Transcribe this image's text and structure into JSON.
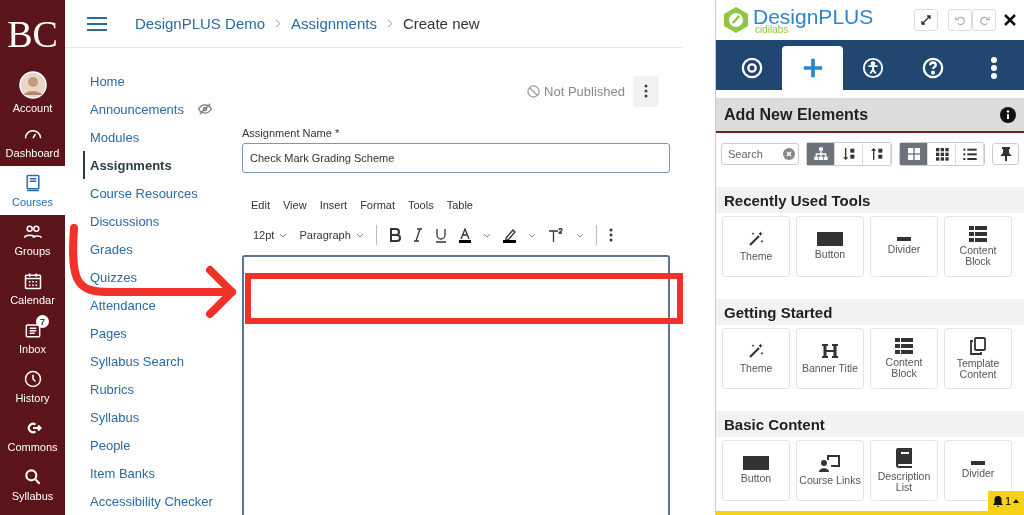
{
  "global_nav": {
    "logo": "BC",
    "items": [
      {
        "label": "Account",
        "selected": false
      },
      {
        "label": "Dashboard",
        "selected": false
      },
      {
        "label": "Courses",
        "selected": true
      },
      {
        "label": "Groups",
        "selected": false
      },
      {
        "label": "Calendar",
        "selected": false
      },
      {
        "label": "Inbox",
        "selected": false,
        "badge": "7"
      },
      {
        "label": "History",
        "selected": false
      },
      {
        "label": "Commons",
        "selected": false
      },
      {
        "label": "Syllabus",
        "selected": false
      }
    ]
  },
  "breadcrumb": [
    "DesignPLUS Demo",
    "Assignments",
    "Create new"
  ],
  "course_nav": [
    {
      "label": "Home",
      "selected": false,
      "hidden": false
    },
    {
      "label": "Announcements",
      "selected": false,
      "hidden": true
    },
    {
      "label": "Modules",
      "selected": false,
      "hidden": false
    },
    {
      "label": "Assignments",
      "selected": true,
      "hidden": false
    },
    {
      "label": "Course Resources",
      "selected": false,
      "hidden": false
    },
    {
      "label": "Discussions",
      "selected": false,
      "hidden": false
    },
    {
      "label": "Grades",
      "selected": false,
      "hidden": false
    },
    {
      "label": "Quizzes",
      "selected": false,
      "hidden": false
    },
    {
      "label": "Attendance",
      "selected": false,
      "hidden": false
    },
    {
      "label": "Pages",
      "selected": false,
      "hidden": false
    },
    {
      "label": "Syllabus Search",
      "selected": false,
      "hidden": false
    },
    {
      "label": "Rubrics",
      "selected": false,
      "hidden": false
    },
    {
      "label": "Syllabus",
      "selected": false,
      "hidden": false
    },
    {
      "label": "People",
      "selected": false,
      "hidden": false
    },
    {
      "label": "Item Banks",
      "selected": false,
      "hidden": false
    },
    {
      "label": "Accessibility Checker",
      "selected": false,
      "hidden": false
    }
  ],
  "publish_status": "Not Published",
  "assignment_name": {
    "label": "Assignment Name *",
    "value": "Check Mark Grading Scheme"
  },
  "editor": {
    "menu": [
      "Edit",
      "View",
      "Insert",
      "Format",
      "Tools",
      "Table"
    ],
    "font_size": "12pt",
    "block_format": "Paragraph"
  },
  "designplus": {
    "logo_title": "DesignPLUS",
    "logo_subtitle": "cidilabs",
    "tabs": [
      {
        "selected": false
      },
      {
        "selected": true
      },
      {
        "selected": false
      },
      {
        "selected": false
      },
      {
        "selected": false
      }
    ],
    "heading": "Add New Elements",
    "search_placeholder": "Search",
    "sort_buttons": [
      {
        "selected": true
      },
      {
        "selected": false
      },
      {
        "selected": false
      }
    ],
    "view_buttons": [
      {
        "selected": true
      },
      {
        "selected": false
      },
      {
        "selected": false
      }
    ],
    "sections": [
      {
        "title": "Recently Used Tools",
        "tools": [
          {
            "label": "Theme",
            "kind": "wand"
          },
          {
            "label": "Button",
            "kind": "button"
          },
          {
            "label": "Divider",
            "kind": "divider"
          },
          {
            "label": "Content Block",
            "kind": "block"
          }
        ]
      },
      {
        "title": "Getting Started",
        "tools": [
          {
            "label": "Theme",
            "kind": "wand"
          },
          {
            "label": "Banner Title",
            "kind": "heading"
          },
          {
            "label": "Content Block",
            "kind": "block"
          },
          {
            "label": "Template Content",
            "kind": "copy"
          }
        ]
      },
      {
        "title": "Basic Content",
        "tools": [
          {
            "label": "Button",
            "kind": "button"
          },
          {
            "label": "Course Links",
            "kind": "links"
          },
          {
            "label": "Description List",
            "kind": "book"
          },
          {
            "label": "Divider",
            "kind": "divider"
          }
        ]
      }
    ],
    "notification_count": "1"
  }
}
